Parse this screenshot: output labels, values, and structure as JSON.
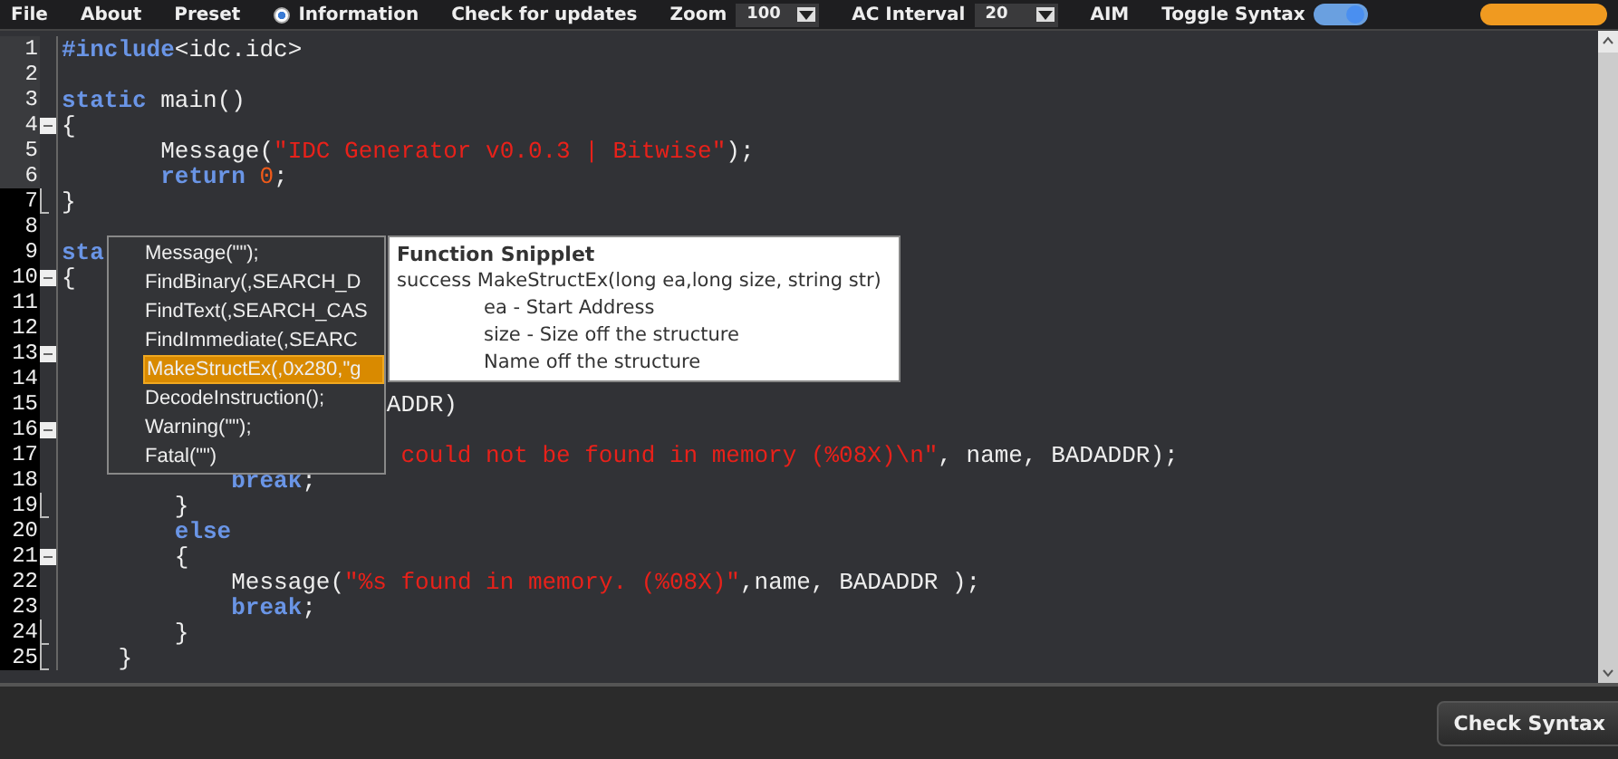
{
  "menu_bar": {
    "items": [
      {
        "kind": "menu",
        "label": "File"
      },
      {
        "kind": "menu",
        "label": "About"
      },
      {
        "kind": "menu",
        "label": "Preset"
      },
      {
        "kind": "radio",
        "label": "Information",
        "selected": true
      },
      {
        "kind": "menu",
        "label": "Check for updates"
      },
      {
        "kind": "select",
        "label": "Zoom",
        "value": "100"
      },
      {
        "kind": "select",
        "label": "AC Interval",
        "value": "20"
      },
      {
        "kind": "menu",
        "label": "AIM"
      },
      {
        "kind": "toggle",
        "label": "Toggle Syntax",
        "on": true
      }
    ]
  },
  "editor": {
    "lines": [
      {
        "number": "1",
        "highlighted": false,
        "fold_start": false,
        "fold_end": false,
        "segments": [
          {
            "kind": "keyword",
            "text": "#include"
          },
          {
            "kind": "plain",
            "text": "<idc.idc>"
          }
        ]
      },
      {
        "number": "2",
        "highlighted": false,
        "fold_start": false,
        "fold_end": false
      },
      {
        "number": "3",
        "highlighted": false,
        "fold_start": false,
        "fold_end": false,
        "segments": [
          {
            "kind": "keyword",
            "text": "static"
          },
          {
            "kind": "plain",
            "text": " main()"
          }
        ]
      },
      {
        "number": "4",
        "highlighted": false,
        "fold_start": true,
        "fold_end": false,
        "segments": [
          {
            "kind": "plain",
            "text": "{"
          }
        ]
      },
      {
        "number": "5",
        "highlighted": false,
        "fold_start": false,
        "fold_end": false,
        "segments": [
          {
            "kind": "plain",
            "text": "       Message("
          },
          {
            "kind": "string",
            "text": "\"IDC Generator v0.0.3 | Bitwise\""
          },
          {
            "kind": "plain",
            "text": ");"
          }
        ]
      },
      {
        "number": "6",
        "highlighted": false,
        "fold_start": false,
        "fold_end": false,
        "segments": [
          {
            "kind": "keyword",
            "text": "       return"
          },
          {
            "kind": "number",
            "text": " 0"
          },
          {
            "kind": "plain",
            "text": ";"
          }
        ]
      },
      {
        "number": "7",
        "highlighted": true,
        "fold_start": false,
        "fold_end": true,
        "segments": [
          {
            "kind": "plain",
            "text": "}"
          }
        ]
      },
      {
        "number": "8",
        "highlighted": true,
        "fold_start": false,
        "fold_end": false
      },
      {
        "number": "9",
        "highlighted": true,
        "fold_start": false,
        "fold_end": false,
        "segments": [
          {
            "kind": "keyword",
            "text": "sta"
          }
        ]
      },
      {
        "number": "10",
        "highlighted": true,
        "fold_start": true,
        "fold_end": false,
        "segments": [
          {
            "kind": "plain",
            "text": "{"
          }
        ]
      },
      {
        "number": "11",
        "highlighted": true,
        "fold_start": false,
        "fold_end": false
      },
      {
        "number": "12",
        "highlighted": true,
        "fold_start": false,
        "fold_end": false
      },
      {
        "number": "13",
        "highlighted": true,
        "fold_start": true,
        "fold_end": false
      },
      {
        "number": "14",
        "highlighted": true,
        "fold_start": false,
        "fold_end": false
      },
      {
        "number": "15",
        "highlighted": true,
        "fold_start": false,
        "fold_end": false,
        "segments": [
          {
            "kind": "plain",
            "text": "                       ADDR)"
          }
        ]
      },
      {
        "number": "16",
        "highlighted": true,
        "fold_start": true,
        "fold_end": false
      },
      {
        "number": "17",
        "highlighted": true,
        "fold_start": false,
        "fold_end": false,
        "segments": [
          {
            "kind": "string",
            "text": "                        could not be found in memory (%08X)\\n\""
          },
          {
            "kind": "plain",
            "text": ", name, BADADDR);"
          }
        ]
      },
      {
        "number": "18",
        "highlighted": true,
        "fold_start": false,
        "fold_end": false,
        "segments": [
          {
            "kind": "keyword",
            "text": "            break"
          },
          {
            "kind": "plain",
            "text": ";"
          }
        ]
      },
      {
        "number": "19",
        "highlighted": true,
        "fold_start": false,
        "fold_end": true,
        "segments": [
          {
            "kind": "plain",
            "text": "        }"
          }
        ]
      },
      {
        "number": "20",
        "highlighted": true,
        "fold_start": false,
        "fold_end": false,
        "segments": [
          {
            "kind": "keyword",
            "text": "        else"
          }
        ]
      },
      {
        "number": "21",
        "highlighted": true,
        "fold_start": true,
        "fold_end": false,
        "segments": [
          {
            "kind": "plain",
            "text": "        {"
          }
        ]
      },
      {
        "number": "22",
        "highlighted": true,
        "fold_start": false,
        "fold_end": false,
        "segments": [
          {
            "kind": "plain",
            "text": "            Message("
          },
          {
            "kind": "string",
            "text": "\"%s found in memory. (%08X)\""
          },
          {
            "kind": "plain",
            "text": ",name, BADADDR );"
          }
        ]
      },
      {
        "number": "23",
        "highlighted": true,
        "fold_start": false,
        "fold_end": false,
        "segments": [
          {
            "kind": "keyword",
            "text": "            break"
          },
          {
            "kind": "plain",
            "text": ";"
          }
        ]
      },
      {
        "number": "24",
        "highlighted": true,
        "fold_start": false,
        "fold_end": true,
        "segments": [
          {
            "kind": "plain",
            "text": "        }"
          }
        ]
      },
      {
        "number": "25",
        "highlighted": true,
        "fold_start": false,
        "fold_end": true,
        "segments": [
          {
            "kind": "plain",
            "text": "    }"
          }
        ]
      }
    ]
  },
  "autocomplete": {
    "items": [
      {
        "label": "Message(\"\");",
        "selected": false
      },
      {
        "label": "FindBinary(,SEARCH_D",
        "selected": false
      },
      {
        "label": "FindText(,SEARCH_CAS",
        "selected": false
      },
      {
        "label": "FindImmediate(,SEARC",
        "selected": false
      },
      {
        "label": "MakeStructEx(,0x280,\"g",
        "selected": true
      },
      {
        "label": "DecodeInstruction();",
        "selected": false
      },
      {
        "label": "Warning(\"\");",
        "selected": false
      },
      {
        "label": "Fatal(\"\")",
        "selected": false
      }
    ]
  },
  "tooltip": {
    "title": "Function Snipplet",
    "signature": "success MakeStructEx(long ea,long size, string str)",
    "params": [
      "ea - Start Address",
      "size - Size off the structure",
      "Name off the structure"
    ]
  },
  "footer": {
    "button": "Check Syntax"
  }
}
